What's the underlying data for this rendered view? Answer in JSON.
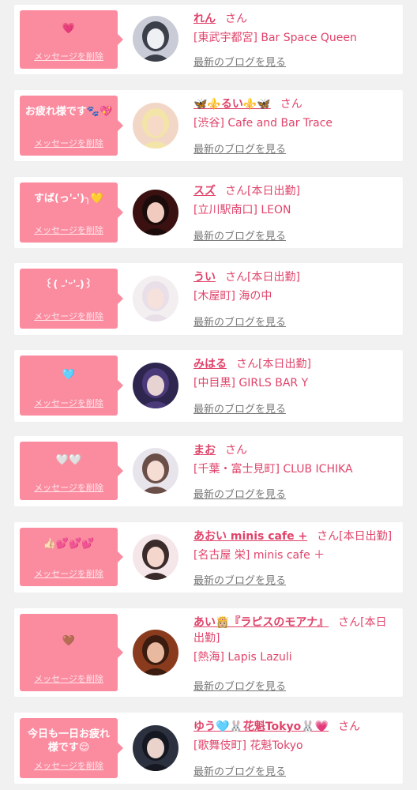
{
  "colors": {
    "page_bg": "#f1f1f1",
    "card_bg": "#ffffff",
    "bubble_bg": "#fb8ca0",
    "accent_text": "#e0436a",
    "link_gray": "#777777"
  },
  "labels": {
    "san": "さん",
    "delete_message": "メッセージを削除",
    "latest_blog": "最新のブログを見る"
  },
  "items": [
    {
      "message": "💗",
      "name": "れん",
      "today": "",
      "shop": "[東武宇都宮] Bar Space Queen",
      "avatar_icon": "girl-photo-avatar"
    },
    {
      "message": "お疲れ様です🐾💖",
      "name": "🦋⚜️るい⚜️🦋",
      "today": "",
      "shop": "[渋谷] Cafe and Bar Trace",
      "avatar_icon": "girl-photo-avatar"
    },
    {
      "message": "すば(っ'-')╮💛",
      "name": "スズ",
      "today": "[本日出勤]",
      "shop": "[立川駅南口] LEON",
      "avatar_icon": "girl-photo-avatar"
    },
    {
      "message": "꒰( ˶'ᵕ'˶)꒱",
      "name": "うい",
      "today": "[本日出勤]",
      "shop": "[木屋町] 海の中",
      "avatar_icon": "girl-photo-avatar"
    },
    {
      "message": "🩵",
      "name": "みはる",
      "today": "[本日出勤]",
      "shop": "[中目黒] GIRLS BAR Y",
      "avatar_icon": "girl-photo-avatar"
    },
    {
      "message": "🤍🤍",
      "name": "まお",
      "today": "",
      "shop": "[千葉・富士見町] CLUB ICHIKA",
      "avatar_icon": "girl-photo-avatar"
    },
    {
      "message": "👍🏻💕💕💕",
      "name": "あおい minis cafe +",
      "today": "[本日出勤]",
      "shop": "[名古屋 栄] minis cafe ＋",
      "avatar_icon": "girl-photo-avatar"
    },
    {
      "message": "🤎",
      "name": "あい👸🏼『ラピスのモアナ』",
      "today": "[本日出勤]",
      "shop": "[熱海] Lapis Lazuli",
      "avatar_icon": "girl-photo-avatar"
    },
    {
      "message": "今日も一日お疲れ様です😌",
      "name": "ゆう🩵🐰花魁Tokyo🐰💗",
      "today": "",
      "shop": "[歌舞伎町] 花魁Tokyo",
      "avatar_icon": "girl-photo-avatar"
    }
  ]
}
